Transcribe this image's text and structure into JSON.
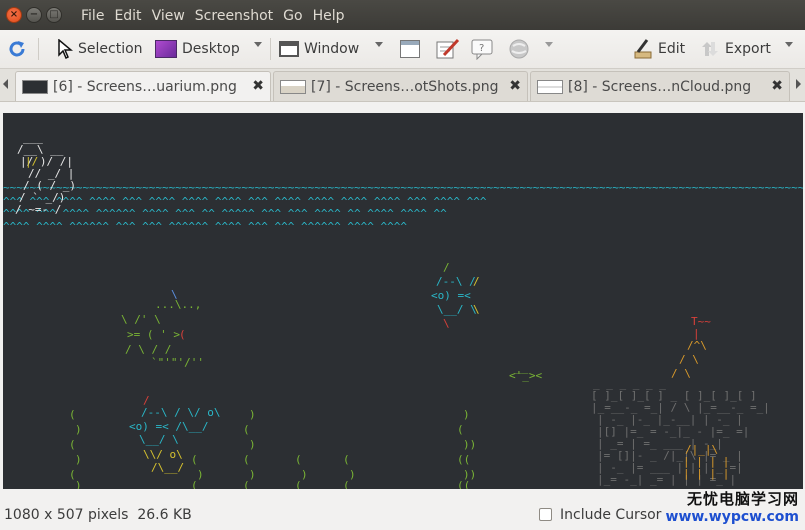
{
  "window": {
    "close": "×",
    "minimize": "−",
    "maximize": "□"
  },
  "menu": [
    "File",
    "Edit",
    "View",
    "Screenshot",
    "Go",
    "Help"
  ],
  "toolbar": {
    "selection": "Selection",
    "desktop": "Desktop",
    "window": "Window",
    "edit": "Edit",
    "export": "Export"
  },
  "tabs": [
    {
      "label": "[6] - Screens…uarium.png",
      "active": true
    },
    {
      "label": "[7] - Screens…otShots.png",
      "active": false
    },
    {
      "label": "[8] - Screens…nCloud.png",
      "active": false
    }
  ],
  "tab_close": "✖",
  "screenshot": {
    "bg": "#2c2f33",
    "colors": {
      "white": "#e8e8e8",
      "cyan": "#2ab7c8",
      "green": "#7ab535",
      "yellow": "#d7c32f",
      "red": "#d8403a",
      "blue": "#5b8fe0",
      "gray": "#6f6f6f",
      "orange": "#d99a2b"
    }
  },
  "status": {
    "dimensions": "1080 x 507 pixels",
    "size": "26.6 KB",
    "include_cursor": "Include Cursor",
    "include_cursor_checked": false
  },
  "watermark": {
    "cn": "无忧电脑学习网",
    "en": "www.wypcw.com"
  }
}
